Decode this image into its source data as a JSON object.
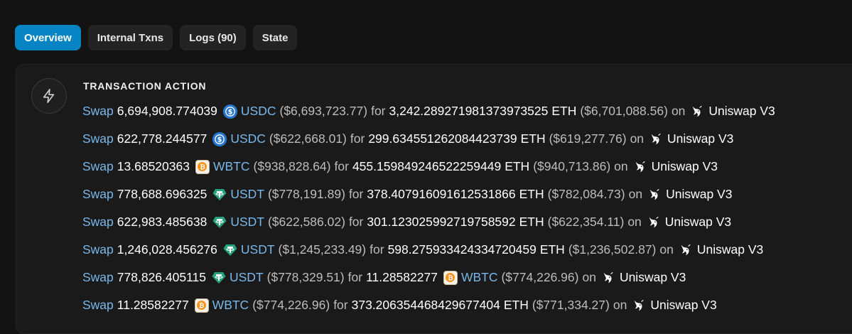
{
  "tabs": [
    {
      "label": "Overview",
      "active": true
    },
    {
      "label": "Internal Txns",
      "active": false
    },
    {
      "label": "Logs (90)",
      "active": false
    },
    {
      "label": "State",
      "active": false
    }
  ],
  "section_title": "TRANSACTION ACTION",
  "section_icon": "lightning-bolt-icon",
  "colors": {
    "accent": "#0784c3",
    "link": "#79b8ea",
    "usdc": "#2775ca",
    "usdt": "#26a17b",
    "wbtc": "#f7931a"
  },
  "actions": [
    {
      "verb": "Swap",
      "amount_in": "6,694,908.774039",
      "token_in": "USDC",
      "token_in_icon": "usdc-icon",
      "usd_in": "($6,693,723.77)",
      "for_word": "for",
      "amount_out": "3,242.289271981373973525",
      "token_out": "ETH",
      "token_out_icon": "",
      "usd_out": "($6,701,088.56)",
      "on_word": "on",
      "dex": "Uniswap V3"
    },
    {
      "verb": "Swap",
      "amount_in": "622,778.244577",
      "token_in": "USDC",
      "token_in_icon": "usdc-icon",
      "usd_in": "($622,668.01)",
      "for_word": "for",
      "amount_out": "299.634551262084423739",
      "token_out": "ETH",
      "token_out_icon": "",
      "usd_out": "($619,277.76)",
      "on_word": "on",
      "dex": "Uniswap V3"
    },
    {
      "verb": "Swap",
      "amount_in": "13.68520363",
      "token_in": "WBTC",
      "token_in_icon": "wbtc-icon",
      "usd_in": "($938,828.64)",
      "for_word": "for",
      "amount_out": "455.159849246522259449",
      "token_out": "ETH",
      "token_out_icon": "",
      "usd_out": "($940,713.86)",
      "on_word": "on",
      "dex": "Uniswap V3"
    },
    {
      "verb": "Swap",
      "amount_in": "778,688.696325",
      "token_in": "USDT",
      "token_in_icon": "usdt-icon",
      "usd_in": "($778,191.89)",
      "for_word": "for",
      "amount_out": "378.407916091612531866",
      "token_out": "ETH",
      "token_out_icon": "",
      "usd_out": "($782,084.73)",
      "on_word": "on",
      "dex": "Uniswap V3"
    },
    {
      "verb": "Swap",
      "amount_in": "622,983.485638",
      "token_in": "USDT",
      "token_in_icon": "usdt-icon",
      "usd_in": "($622,586.02)",
      "for_word": "for",
      "amount_out": "301.123025992719758592",
      "token_out": "ETH",
      "token_out_icon": "",
      "usd_out": "($622,354.11)",
      "on_word": "on",
      "dex": "Uniswap V3"
    },
    {
      "verb": "Swap",
      "amount_in": "1,246,028.456276",
      "token_in": "USDT",
      "token_in_icon": "usdt-icon",
      "usd_in": "($1,245,233.49)",
      "for_word": "for",
      "amount_out": "598.275933424334720459",
      "token_out": "ETH",
      "token_out_icon": "",
      "usd_out": "($1,236,502.87)",
      "on_word": "on",
      "dex": "Uniswap V3"
    },
    {
      "verb": "Swap",
      "amount_in": "778,826.405115",
      "token_in": "USDT",
      "token_in_icon": "usdt-icon",
      "usd_in": "($778,329.51)",
      "for_word": "for",
      "amount_out": "11.28582277",
      "token_out": "WBTC",
      "token_out_icon": "wbtc-icon",
      "usd_out": "($774,226.96)",
      "on_word": "on",
      "dex": "Uniswap V3"
    },
    {
      "verb": "Swap",
      "amount_in": "11.28582277",
      "token_in": "WBTC",
      "token_in_icon": "wbtc-icon",
      "usd_in": "($774,226.96)",
      "for_word": "for",
      "amount_out": "373.206354468429677404",
      "token_out": "ETH",
      "token_out_icon": "",
      "usd_out": "($771,334.27)",
      "on_word": "on",
      "dex": "Uniswap V3"
    }
  ]
}
